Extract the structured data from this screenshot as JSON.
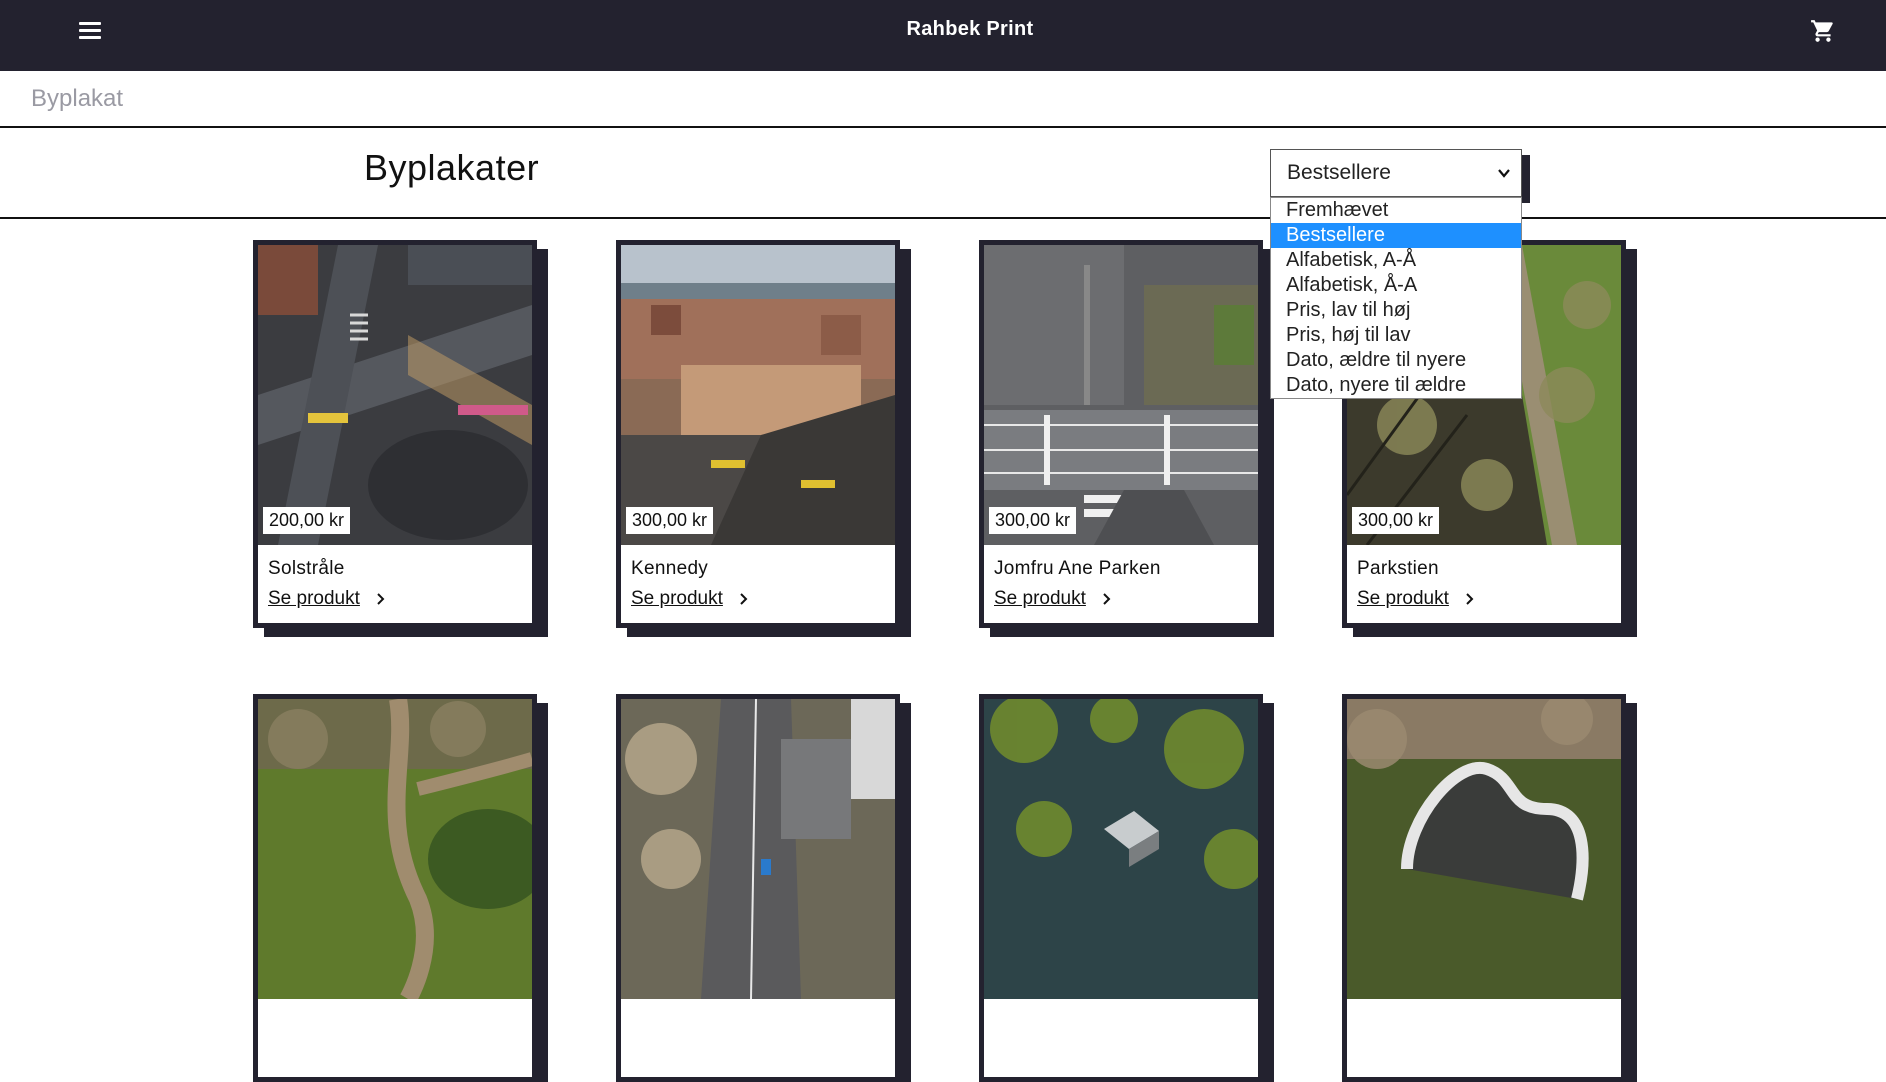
{
  "header": {
    "brand": "Rahbek Print",
    "menu_icon": "hamburger-icon",
    "cart_icon": "cart-icon",
    "bg_color": "#23222f"
  },
  "breadcrumb": "Byplakat",
  "page_title": "Byplakater",
  "sort": {
    "selected": "Bestsellere",
    "options": [
      "Fremhævet",
      "Bestsellere",
      "Alfabetisk, A-Å",
      "Alfabetisk, Å-A",
      "Pris, lav til høj",
      "Pris, høj til lav",
      "Dato, ældre til nyere",
      "Dato, nyere til ældre"
    ],
    "highlight_color": "#1e90ff"
  },
  "products": [
    {
      "name": "Solstråle",
      "price": "200,00 kr",
      "link": "Se produkt"
    },
    {
      "name": "Kennedy",
      "price": "300,00 kr",
      "link": "Se produkt"
    },
    {
      "name": "Jomfru Ane Parken",
      "price": "300,00 kr",
      "link": "Se produkt"
    },
    {
      "name": "Parkstien",
      "price": "300,00 kr",
      "link": "Se produkt"
    },
    {
      "name": "",
      "price": "",
      "link": ""
    },
    {
      "name": "",
      "price": "",
      "link": ""
    },
    {
      "name": "",
      "price": "",
      "link": ""
    },
    {
      "name": "",
      "price": "",
      "link": ""
    }
  ]
}
